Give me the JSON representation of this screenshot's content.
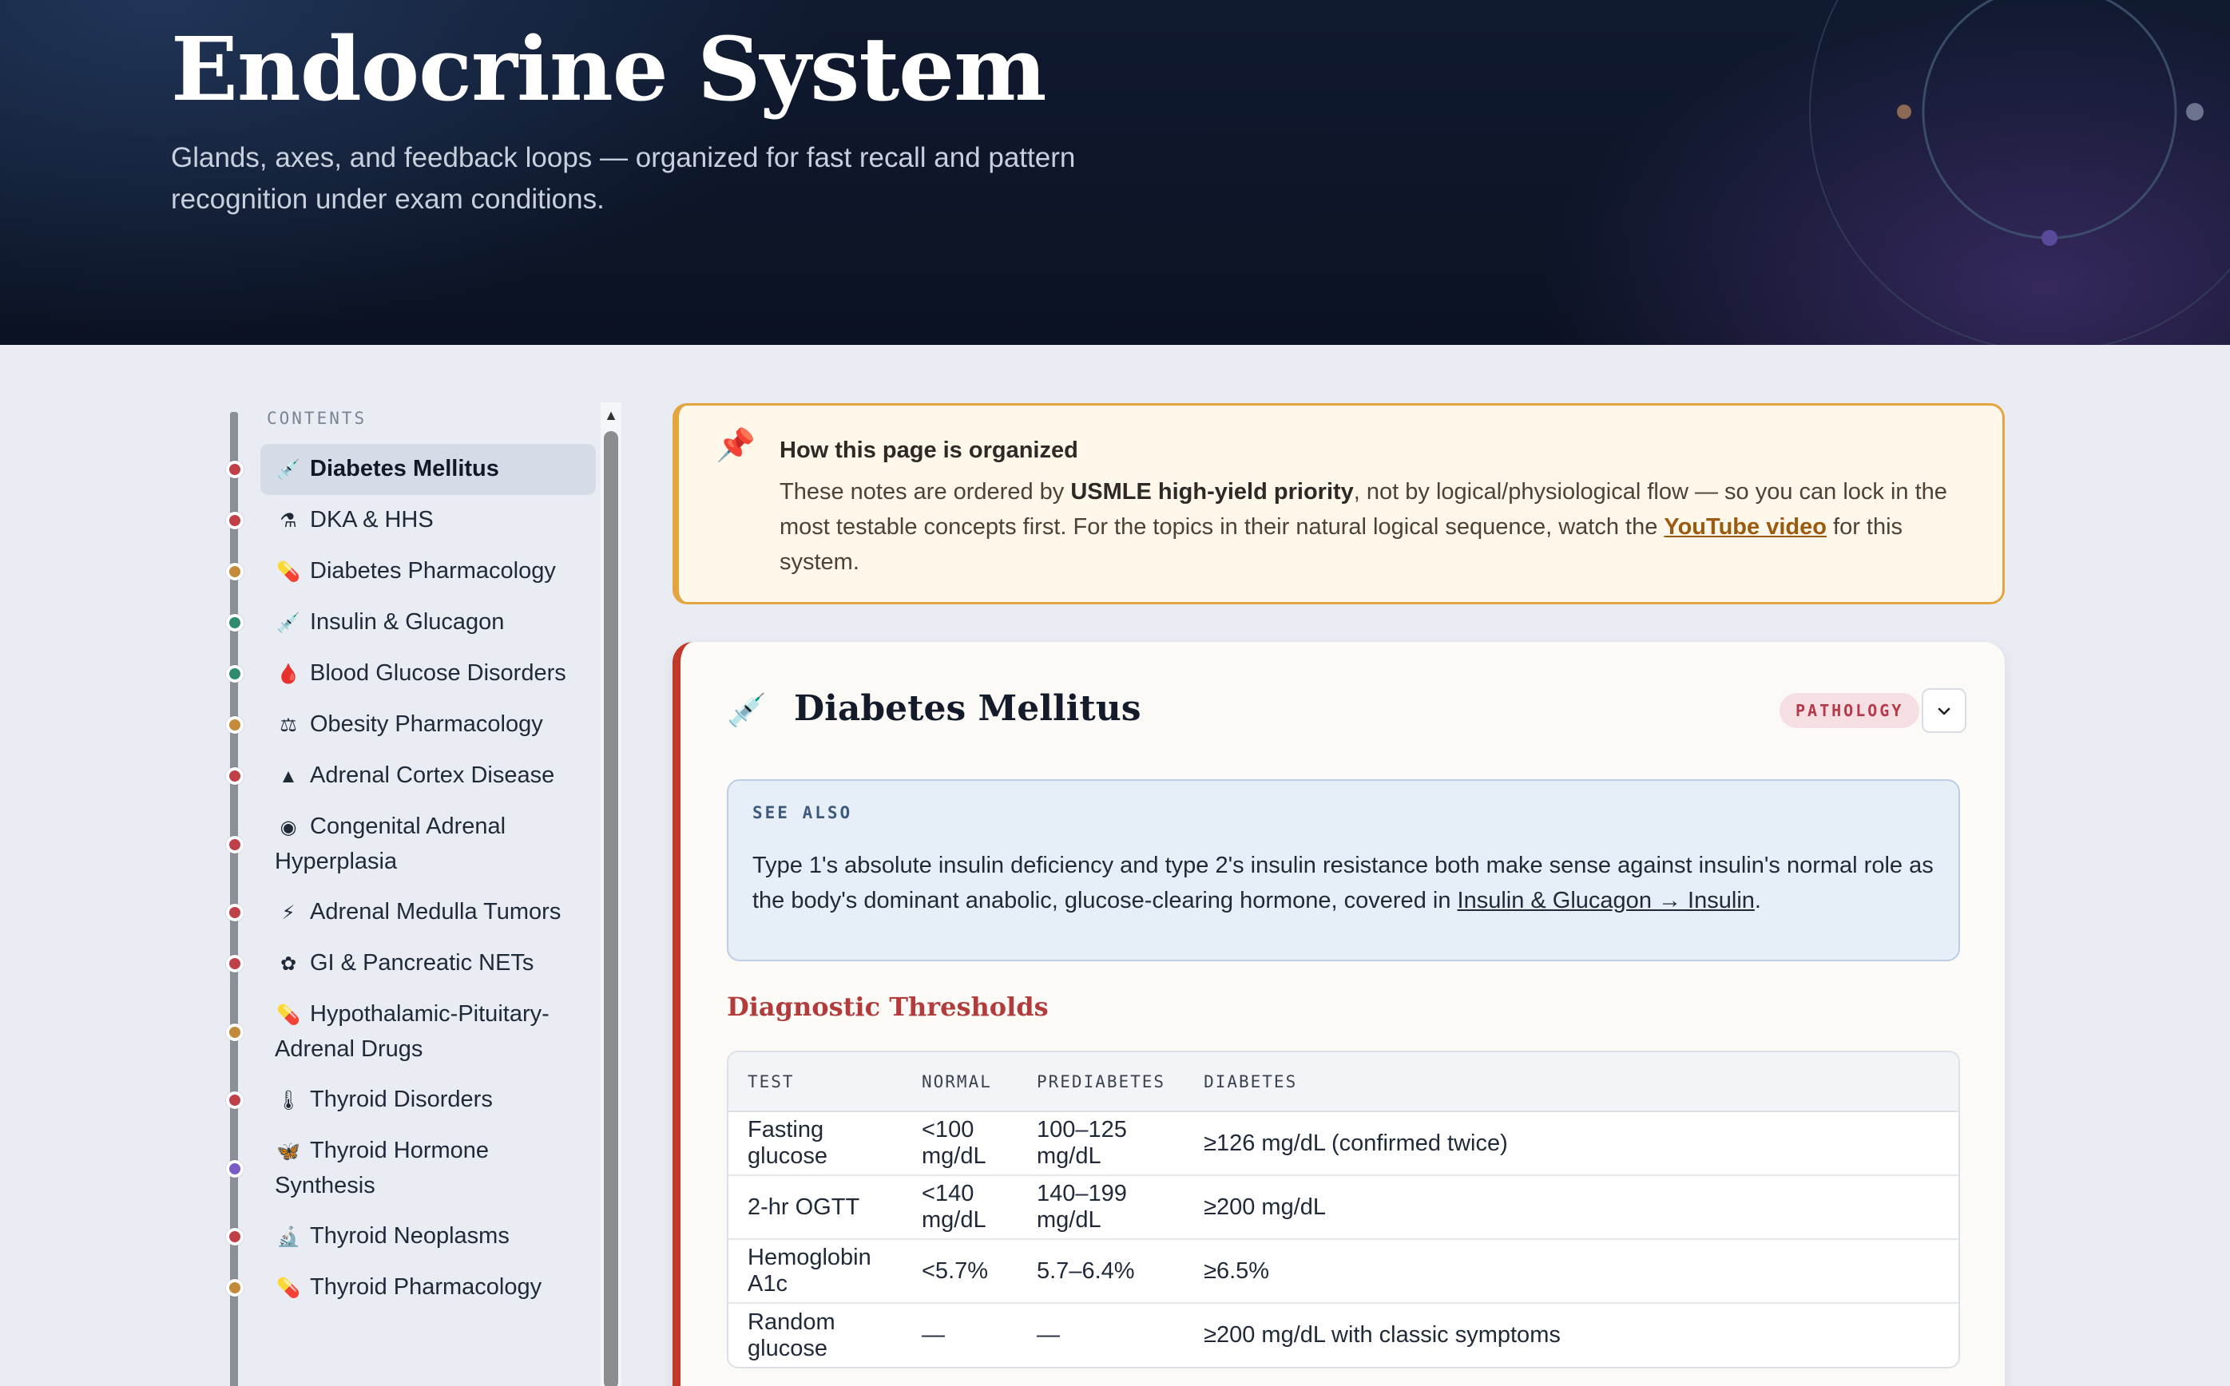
{
  "hero": {
    "title": "Endocrine System",
    "subtitle": "Glands, axes, and feedback loops — organized for fast recall and pattern recognition under exam conditions."
  },
  "sidebar": {
    "label": "CONTENTS",
    "items": [
      {
        "label": "Diabetes Mellitus",
        "icon": "syringe-icon",
        "glyph": "💉",
        "dot": "#c0404a",
        "active": true
      },
      {
        "label": "DKA & HHS",
        "icon": "flask-icon",
        "glyph": "⚗",
        "dot": "#c0404a"
      },
      {
        "label": "Diabetes Pharmacology",
        "icon": "pill-icon",
        "glyph": "💊",
        "dot": "#c48a3a"
      },
      {
        "label": "Insulin & Glucagon",
        "icon": "syringe-icon",
        "glyph": "💉",
        "dot": "#2e8b6e"
      },
      {
        "label": "Blood Glucose Disorders",
        "icon": "blood-drop-icon",
        "glyph": "🩸",
        "dot": "#2e8b6e"
      },
      {
        "label": "Obesity Pharmacology",
        "icon": "scales-icon",
        "glyph": "⚖",
        "dot": "#c48a3a"
      },
      {
        "label": "Adrenal Cortex Disease",
        "icon": "triangle-icon",
        "glyph": "▲",
        "dot": "#c0404a"
      },
      {
        "label": "Congenital Adrenal Hyperplasia",
        "icon": "dna-icon",
        "glyph": "◉",
        "dot": "#c0404a"
      },
      {
        "label": "Adrenal Medulla Tumors",
        "icon": "lightning-icon",
        "glyph": "⚡",
        "dot": "#c0404a"
      },
      {
        "label": "GI & Pancreatic NETs",
        "icon": "cells-icon",
        "glyph": "✿",
        "dot": "#c0404a"
      },
      {
        "label": "Hypothalamic-Pituitary-Adrenal Drugs",
        "icon": "pill-icon",
        "glyph": "💊",
        "dot": "#c48a3a"
      },
      {
        "label": "Thyroid Disorders",
        "icon": "thermometer-icon",
        "glyph": "🌡",
        "dot": "#c0404a"
      },
      {
        "label": "Thyroid Hormone Synthesis",
        "icon": "butterfly-icon",
        "glyph": "🦋",
        "dot": "#7a5cc4"
      },
      {
        "label": "Thyroid Neoplasms",
        "icon": "microscope-icon",
        "glyph": "🔬",
        "dot": "#c0404a"
      },
      {
        "label": "Thyroid Pharmacology",
        "icon": "pill-icon",
        "glyph": "💊",
        "dot": "#c48a3a"
      }
    ]
  },
  "callout": {
    "title": "How this page is organized",
    "body_pre": "These notes are ordered by ",
    "body_bold": "USMLE high-yield priority",
    "body_mid": ", not by logical/physiological flow — so you can lock in the most testable concepts first. For the topics in their natural logical sequence, watch the ",
    "body_link": "YouTube video",
    "body_post": " for this system."
  },
  "card": {
    "title": "Diabetes Mellitus",
    "badge": "PATHOLOGY",
    "see_also": {
      "label": "SEE ALSO",
      "body_pre": "Type 1's absolute insulin deficiency and type 2's insulin resistance both make sense against insulin's normal role as the body's dominant anabolic, glucose-clearing hormone, covered in ",
      "link": "Insulin & Glucagon → Insulin",
      "body_post": "."
    },
    "section_title": "Diagnostic Thresholds",
    "table": {
      "headers": [
        "TEST",
        "NORMAL",
        "PREDIABETES",
        "DIABETES"
      ],
      "rows": [
        [
          "Fasting glucose",
          "<100 mg/dL",
          "100–125 mg/dL",
          "≥126 mg/dL (confirmed twice)"
        ],
        [
          "2-hr OGTT",
          "<140 mg/dL",
          "140–199 mg/dL",
          "≥200 mg/dL"
        ],
        [
          "Hemoglobin A1c",
          "<5.7%",
          "5.7–6.4%",
          "≥6.5%"
        ],
        [
          "Random glucose",
          "—",
          "—",
          "≥200 mg/dL with classic symptoms"
        ]
      ]
    }
  },
  "colors": {
    "hero_bg": "#0b1222",
    "accent_red": "#c0392b",
    "callout_border": "#e4a540",
    "badge_text": "#b4394a"
  }
}
